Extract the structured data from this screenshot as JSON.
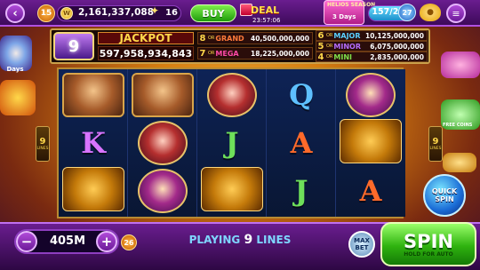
{
  "topbar": {
    "back_icon": "‹",
    "level": "15",
    "coin_symbol": "W",
    "coins": "2,161,337,088",
    "wand_count": "16",
    "buy_label": "BUY",
    "deal_label": "DEAL",
    "deal_timer": "23:57:06",
    "days_title": "HELIOS SEASON",
    "days_label": "3 Days",
    "progress_text": "157/200",
    "progress_fraction": 0.785,
    "vip_level": "27",
    "menu_icon": "≡"
  },
  "jackpot": {
    "nine": "9",
    "title": "JACKPOT",
    "value": "597,958,934,843",
    "or_label": "OR",
    "tiers": [
      {
        "num": "8",
        "name": "GRAND",
        "value": "40,500,000,000",
        "color": "#ff7a3a"
      },
      {
        "num": "7",
        "name": "MEGA",
        "value": "18,225,000,000",
        "color": "#ff4aa8"
      },
      {
        "num": "6",
        "name": "MAJOR",
        "value": "10,125,000,000",
        "color": "#5ad0ff"
      },
      {
        "num": "5",
        "name": "MINOR",
        "value": "6,075,000,000",
        "color": "#b36cff"
      },
      {
        "num": "4",
        "name": "MINI",
        "value": "2,835,000,000",
        "color": "#7fe04a"
      }
    ]
  },
  "reels": {
    "lines_left": "9",
    "lines_right": "9",
    "lines_word": "LINES",
    "letters": {
      "q": "Q",
      "k": "K",
      "j": "J",
      "a": "A"
    }
  },
  "promos": {
    "left_label": "Days",
    "right_label": "FREE COINS"
  },
  "controls": {
    "minus": "−",
    "bet": "405M",
    "plus": "+",
    "level_chip": "26",
    "playing_prefix": "PLAYING ",
    "playing_lines": "9",
    "playing_suffix": " LINES",
    "maxbet": "MAX BET",
    "spin": "SPIN",
    "spin_sub": "HOLD FOR AUTO",
    "quick_spin_1": "QUICK",
    "quick_spin_2": "SPIN"
  }
}
